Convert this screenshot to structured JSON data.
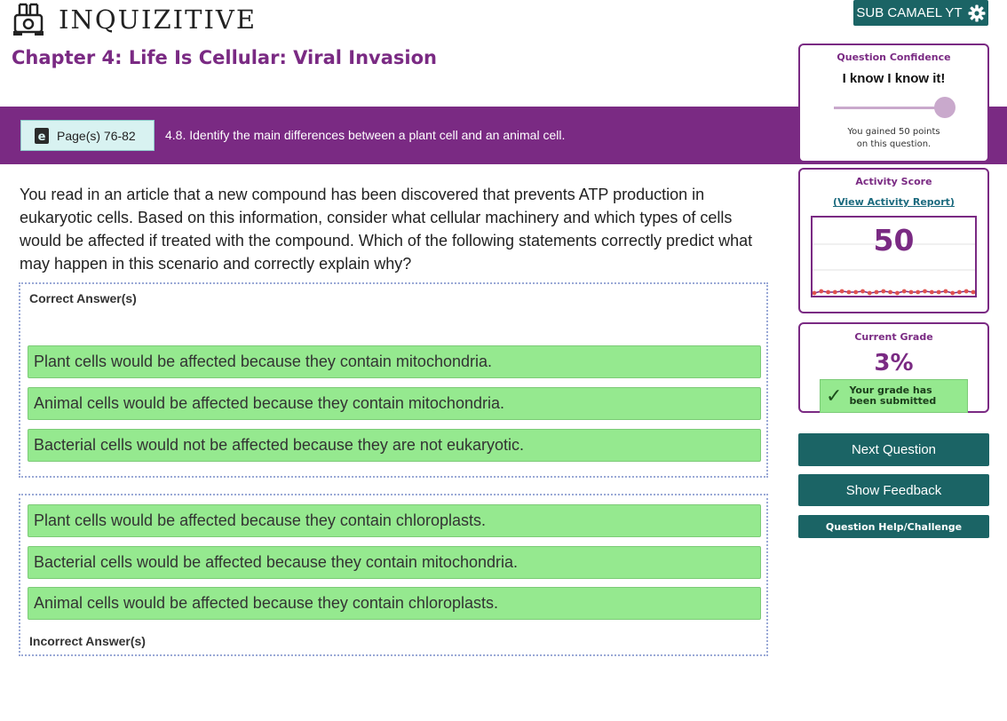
{
  "header": {
    "logo_text": "INQUIZITIVE",
    "user_label": "SUB CAMAEL YT"
  },
  "chapter_title": "Chapter 4: Life Is Cellular: Viral Invasion",
  "objective_bar": {
    "pages_label": "Page(s) 76-82",
    "objective": "4.8. Identify the main differences between a plant cell and an animal cell."
  },
  "question": "You read in an article that a new compound has been discovered that prevents ATP production in eukaryotic cells. Based on this information, consider what cellular machinery and which types of cells would be affected if treated with the compound. Which of the following statements correctly predict what may happen in this scenario and correctly explain why?",
  "correct": {
    "label": "Correct Answer(s)",
    "answers": [
      "Plant cells would be affected because they contain mitochondria.",
      "Animal cells would be affected because they contain mitochondria.",
      "Bacterial cells would not be affected because they are not eukaryotic."
    ]
  },
  "incorrect": {
    "label": "Incorrect Answer(s)",
    "answers": [
      "Plant cells would be affected because they contain chloroplasts.",
      "Bacterial cells would be affected because they contain mitochondria.",
      "Animal cells would be affected because they contain chloroplasts."
    ]
  },
  "confidence": {
    "title": "Question Confidence",
    "value": "I know I know it!",
    "level": 1.0,
    "note": "You gained 50 points\non this question."
  },
  "activity": {
    "title": "Activity Score",
    "report_link": "(View Activity Report)",
    "score": "50"
  },
  "grade": {
    "title": "Current Grade",
    "value": "3%",
    "status": "Your grade has been submitted"
  },
  "buttons": {
    "next": "Next Question",
    "feedback": "Show Feedback",
    "help": "Question Help/Challenge"
  },
  "colors": {
    "brand_purple": "#7a2a83",
    "button_teal": "#1b6465",
    "answer_green": "#95e98f"
  }
}
